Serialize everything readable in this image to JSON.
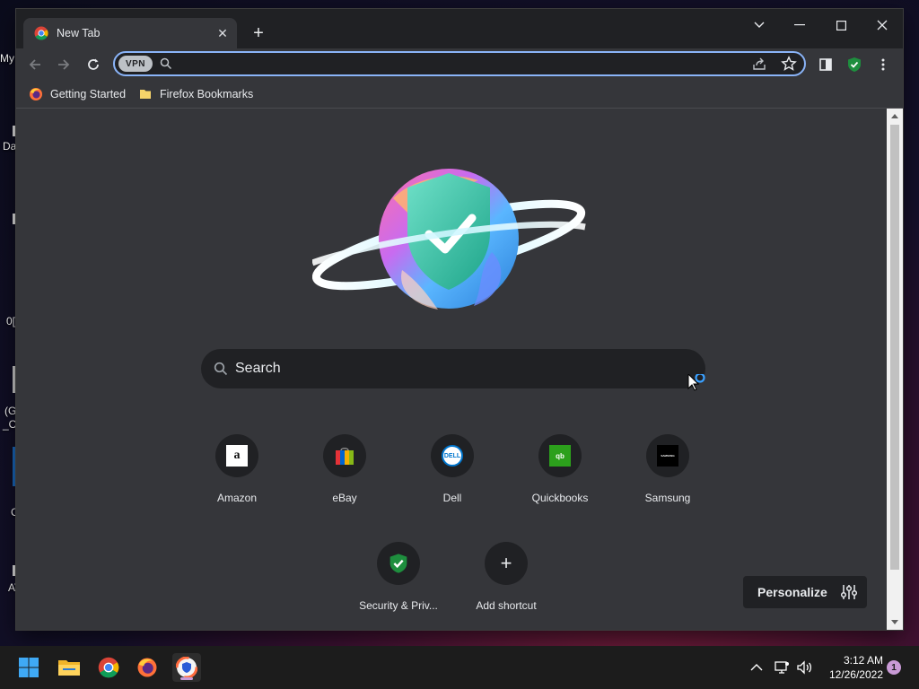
{
  "desktop": {
    "fragments": [
      "My",
      "Da",
      "0[",
      "(G",
      "_O",
      "C",
      "AV"
    ]
  },
  "browser": {
    "tab": {
      "title": "New Tab",
      "close_icon": "close-icon"
    },
    "new_tab_icon": "plus-icon",
    "window_controls": [
      "chevron-down-icon",
      "minimize-icon",
      "maximize-icon",
      "close-icon"
    ],
    "toolbar": {
      "back_icon": "back-arrow-icon",
      "forward_icon": "forward-arrow-icon",
      "reload_icon": "reload-icon",
      "vpn_label": "VPN",
      "address_value": "",
      "address_placeholder": "",
      "share_icon": "share-icon",
      "star_icon": "star-icon",
      "sidepanel_icon": "side-panel-icon",
      "shield_icon": "shield-check-icon",
      "menu_icon": "kebab-menu-icon"
    },
    "bookmarks": [
      {
        "label": "Getting Started",
        "icon": "firefox-icon"
      },
      {
        "label": "Firefox Bookmarks",
        "icon": "folder-icon"
      }
    ]
  },
  "newtab": {
    "search_label": "Search",
    "shortcuts": [
      {
        "label": "Amazon",
        "icon": "amazon-icon",
        "glyph": "a"
      },
      {
        "label": "eBay",
        "icon": "ebay-icon",
        "glyph": ""
      },
      {
        "label": "Dell",
        "icon": "dell-icon",
        "glyph": "DELL"
      },
      {
        "label": "Quickbooks",
        "icon": "quickbooks-icon",
        "glyph": "qb"
      },
      {
        "label": "Samsung",
        "icon": "samsung-icon",
        "glyph": "SAMSUNG"
      },
      {
        "label": "Security & Priv...",
        "icon": "shield-check-icon",
        "glyph": ""
      },
      {
        "label": "Add shortcut",
        "icon": "plus-icon",
        "glyph": "+"
      }
    ],
    "personalize_label": "Personalize"
  },
  "taskbar": {
    "apps": [
      "windows-start-icon",
      "file-explorer-icon",
      "chrome-icon",
      "firefox-icon",
      "avast-browser-icon"
    ],
    "tray_icons": [
      "chevron-up-icon",
      "network-icon",
      "volume-icon"
    ],
    "time": "3:12 AM",
    "date": "12/26/2022",
    "notification_count": "1"
  },
  "colors": {
    "accent": "#8ab4f8",
    "window_bg": "#202124",
    "toolbar_bg": "#35363a",
    "shield_green": "#1e8e3e",
    "taskbar_bg": "#1c1c1c"
  }
}
